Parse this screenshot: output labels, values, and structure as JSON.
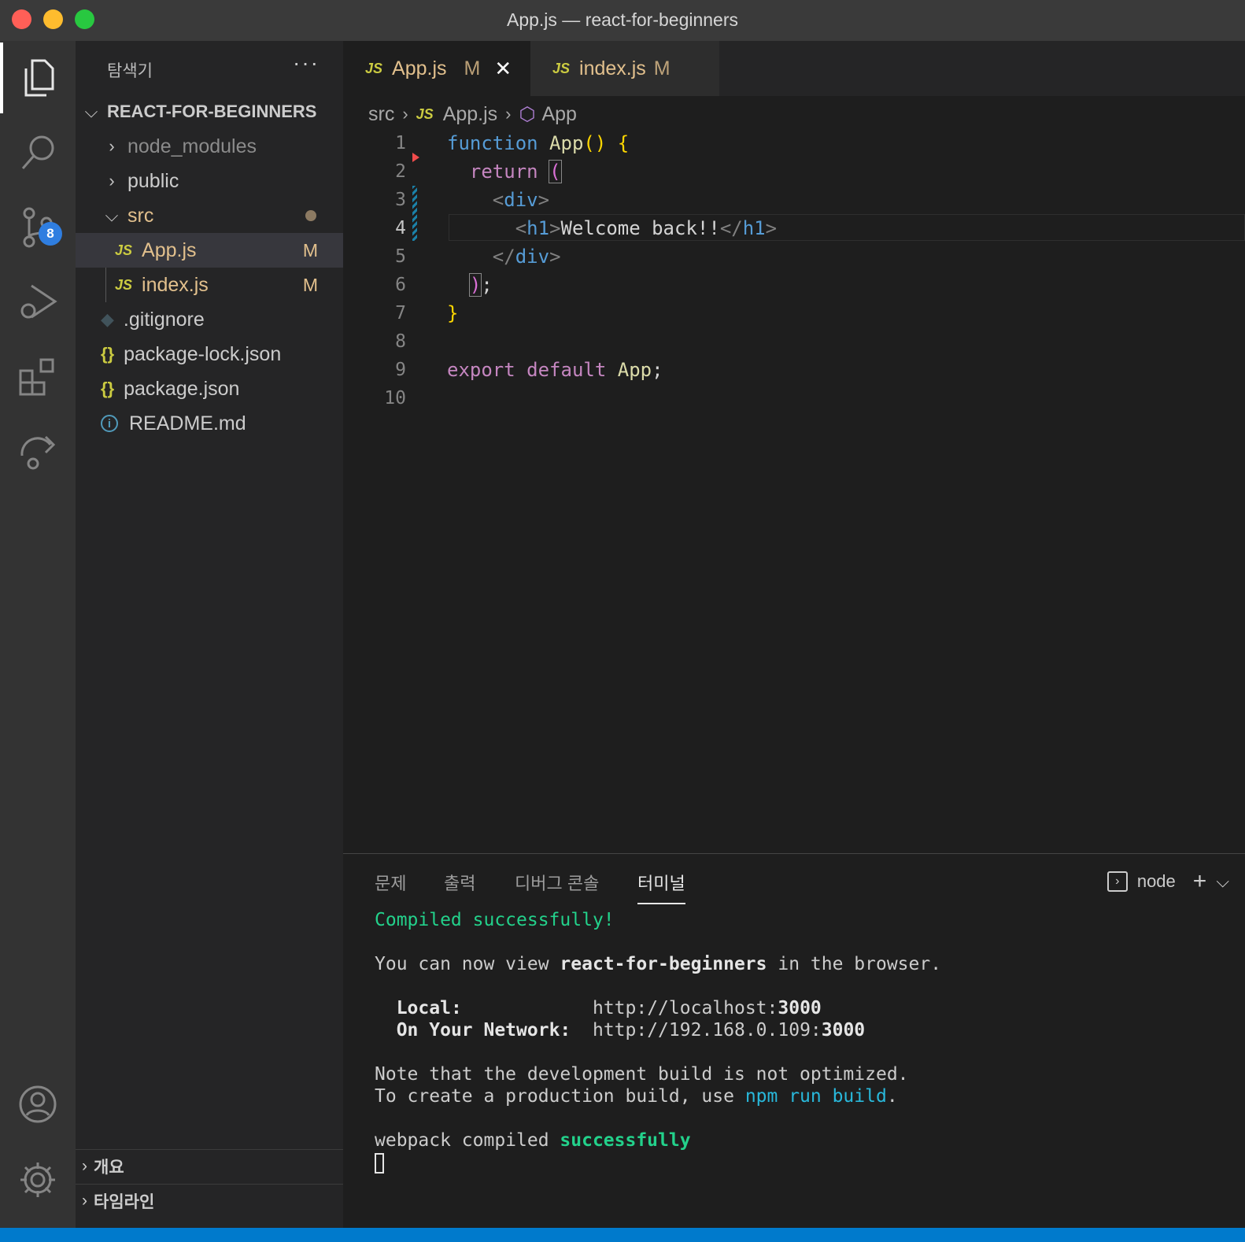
{
  "window": {
    "title": "App.js — react-for-beginners"
  },
  "activity_bar": {
    "source_control_badge": "8"
  },
  "sidebar": {
    "header": "탐색기",
    "more": "···",
    "root_folder": "REACT-FOR-BEGINNERS",
    "items": [
      {
        "label": "node_modules"
      },
      {
        "label": "public"
      },
      {
        "label": "src"
      },
      {
        "label": "App.js",
        "status": "M"
      },
      {
        "label": "index.js",
        "status": "M"
      },
      {
        "label": ".gitignore"
      },
      {
        "label": "package-lock.json"
      },
      {
        "label": "package.json"
      },
      {
        "label": "README.md"
      }
    ],
    "sections": [
      "개요",
      "타임라인"
    ]
  },
  "tabs": [
    {
      "icon": "JS",
      "label": "App.js",
      "status": "M"
    },
    {
      "icon": "JS",
      "label": "index.js",
      "status": "M"
    }
  ],
  "breadcrumb": {
    "folder": "src",
    "file_icon": "JS",
    "file": "App.js",
    "symbol": "App"
  },
  "editor": {
    "line_numbers": [
      "1",
      "2",
      "3",
      "4",
      "5",
      "6",
      "7",
      "8",
      "9",
      "10"
    ],
    "current_line": "4",
    "code": {
      "l1_kw": "function",
      "l1_fn": "App",
      "l1_paren": "()",
      "l1_brace": "{",
      "l2_kw": "return",
      "l2_paren": "(",
      "l3_open": "<",
      "l3_tag": "div",
      "l3_close": ">",
      "l4_open": "<",
      "l4_tag": "h1",
      "l4_gt": ">",
      "l4_text": "Welcome back!!",
      "l4_end_open": "</",
      "l4_end_tag": "h1",
      "l4_end_close": ">",
      "l5_open": "</",
      "l5_tag": "div",
      "l5_close": ">",
      "l6_paren": ")",
      "l6_semi": ";",
      "l7_brace": "}",
      "l9_kw1": "export",
      "l9_kw2": "default",
      "l9_name": "App",
      "l9_semi": ";"
    }
  },
  "panel": {
    "tabs": [
      "문제",
      "출력",
      "디버그 콘솔",
      "터미널"
    ],
    "active_tab": "터미널",
    "terminal_name": "node",
    "add": "+",
    "terminal": {
      "compiled": "Compiled successfully!",
      "view_pre": "You can now view ",
      "view_app": "react-for-beginners",
      "view_post": " in the browser.",
      "local_label": "Local:",
      "local_url_pre": "http://localhost:",
      "local_port": "3000",
      "network_label": "On Your Network:",
      "network_url_pre": "http://192.168.0.109:",
      "network_port": "3000",
      "note": "Note that the development build is not optimized.",
      "create_pre": "To create a production build, use ",
      "create_cmd": "npm run build",
      "create_post": ".",
      "webpack_pre": "webpack compiled ",
      "webpack_status": "successfully"
    }
  },
  "colors": {
    "statusbar": "#007acc",
    "activitybar": "#333333",
    "sidebar": "#252526",
    "editor": "#1e1e1e"
  }
}
